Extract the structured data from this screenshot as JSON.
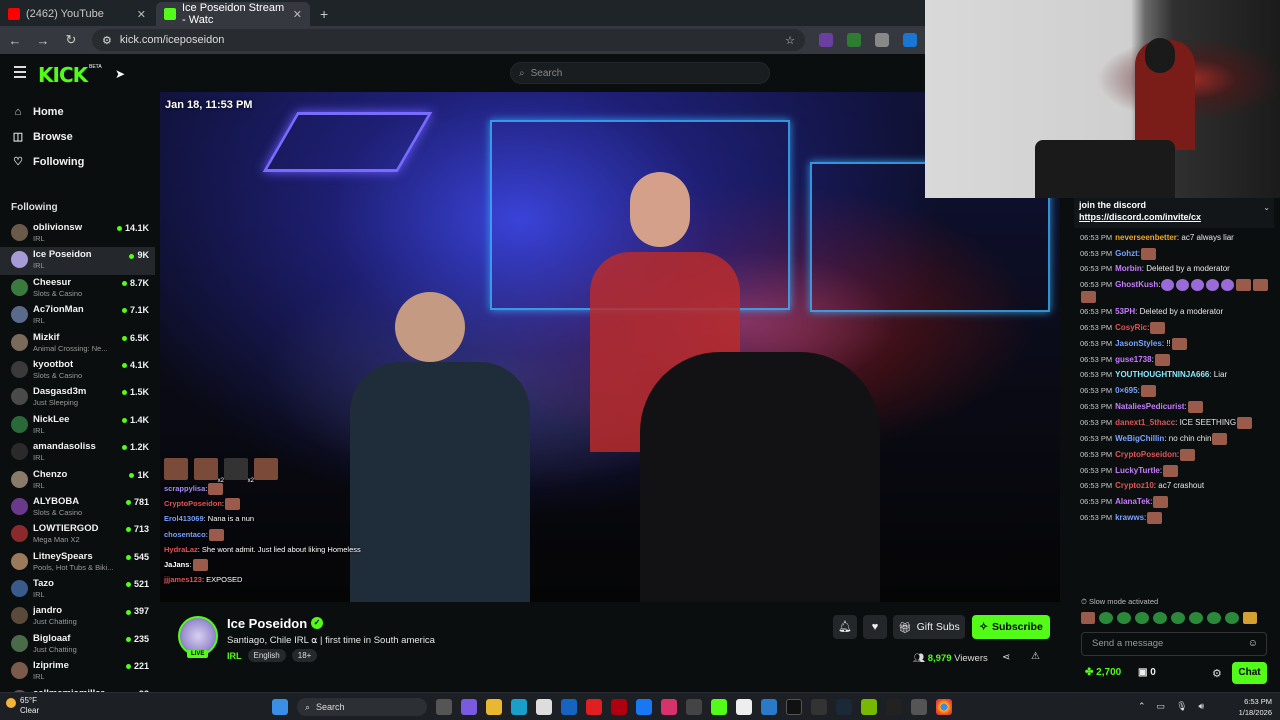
{
  "browser": {
    "tabs": [
      {
        "title": "(2462) YouTube",
        "icon": "youtube-icon",
        "color": "#ff0000"
      },
      {
        "title": "Ice Poseidon Stream - Watc",
        "icon": "kick-icon",
        "color": "#53fc18",
        "active": true
      }
    ],
    "new_tab": "+",
    "url": "kick.com/iceposeidon"
  },
  "kick": {
    "logo": "KICK",
    "beta": "BETA",
    "search_placeholder": "Search"
  },
  "nav": [
    {
      "label": "Home",
      "icon": "home-icon",
      "glyph": "⌂"
    },
    {
      "label": "Browse",
      "icon": "browse-icon",
      "glyph": "◫"
    },
    {
      "label": "Following",
      "icon": "heart-icon",
      "glyph": "♡"
    }
  ],
  "following_heading": "Following",
  "following": [
    {
      "name": "oblivionsw",
      "category": "IRL",
      "viewers": "14.1K",
      "avatar_color": "#6a5a4a"
    },
    {
      "name": "Ice Poseidon",
      "category": "IRL",
      "viewers": "9K",
      "avatar_color": "#a69bd6",
      "active": true
    },
    {
      "name": "Cheesur",
      "category": "Slots & Casino",
      "viewers": "8.7K",
      "avatar_color": "#3b7a3e"
    },
    {
      "name": "Ac7ionMan",
      "category": "IRL",
      "viewers": "7.1K",
      "avatar_color": "#5a6a8a"
    },
    {
      "name": "Mizkif",
      "category": "Animal Crossing: Ne...",
      "viewers": "6.5K",
      "avatar_color": "#7a6a5a"
    },
    {
      "name": "kyootbot",
      "category": "Slots & Casino",
      "viewers": "4.1K",
      "avatar_color": "#3a3a3a"
    },
    {
      "name": "Dasgasd3m",
      "category": "Just Sleeping",
      "viewers": "1.5K",
      "avatar_color": "#4a4a4a"
    },
    {
      "name": "NickLee",
      "category": "IRL",
      "viewers": "1.4K",
      "avatar_color": "#2a6a3a"
    },
    {
      "name": "amandasoliss",
      "category": "IRL",
      "viewers": "1.2K",
      "avatar_color": "#2a2a2a"
    },
    {
      "name": "Chenzo",
      "category": "IRL",
      "viewers": "1K",
      "avatar_color": "#8a7a6a"
    },
    {
      "name": "ALYBOBA",
      "category": "Slots & Casino",
      "viewers": "781",
      "avatar_color": "#6a3a8a"
    },
    {
      "name": "LOWTIERGOD",
      "category": "Mega Man X2",
      "viewers": "713",
      "avatar_color": "#8a2a2a"
    },
    {
      "name": "LitneySpears",
      "category": "Pools, Hot Tubs & Biki...",
      "viewers": "545",
      "avatar_color": "#9a7a5a"
    },
    {
      "name": "Tazo",
      "category": "IRL",
      "viewers": "521",
      "avatar_color": "#3a5a8a"
    },
    {
      "name": "jandro",
      "category": "Just Chatting",
      "viewers": "397",
      "avatar_color": "#5a4a3a"
    },
    {
      "name": "Bigloaaf",
      "category": "Just Chatting",
      "viewers": "235",
      "avatar_color": "#4a6a4a"
    },
    {
      "name": "Iziprime",
      "category": "IRL",
      "viewers": "221",
      "avatar_color": "#7a5a4a"
    },
    {
      "name": "callmemiamiller",
      "category": "",
      "viewers": "92",
      "avatar_color": "#6a4a5a"
    }
  ],
  "video": {
    "timestamp": "Jan 18, 11:53 PM",
    "overlay_counts": [
      "x2",
      "x2"
    ],
    "overlay_chat": [
      {
        "user": "scrappylisa",
        "text": ":",
        "color": "#a78bfa"
      },
      {
        "user": "CryptoPoseidon",
        "text": ":",
        "color": "#e05555"
      },
      {
        "user": "Erol413069",
        "text": ": Nana is a nun",
        "color": "#7aa2ff"
      },
      {
        "user": "chosentaco",
        "text": ":",
        "color": "#7aa2ff"
      },
      {
        "user": "HydraLaz",
        "text": ": She wont admit. Just lied about liking Homeless",
        "color": "#e05555"
      },
      {
        "user": "JaJans",
        "text": ":",
        "color": "#ffffff"
      },
      {
        "user": "jjjames123",
        "text": ": EXPOSED",
        "color": "#e05555"
      }
    ]
  },
  "stream": {
    "name": "Ice Poseidon",
    "live": "LIVE",
    "title": "Santiago, Chile IRL ⍺ | first time in South america",
    "category": "IRL",
    "tags": [
      "English",
      "18+"
    ],
    "gift_label": "Gift Subs",
    "subscribe_label": "Subscribe",
    "viewers": "8,979",
    "viewers_label": "Viewers"
  },
  "chat": {
    "pinned_title": "join the discord",
    "pinned_link": "https://discord.com/invite/cx",
    "messages": [
      {
        "time": "06:53 PM",
        "user": "neverseenbetter",
        "text": ": ac7 always liar",
        "color": "#f0a830"
      },
      {
        "time": "06:53 PM",
        "user": "Gohzt",
        "text": ":",
        "color": "#7aa2ff",
        "emotes": 1
      },
      {
        "time": "06:53 PM",
        "user": "Morbin",
        "text": ": Deleted by a moderator",
        "color": "#c77dff"
      },
      {
        "time": "06:53 PM",
        "user": "GhostKush",
        "text": ":",
        "color": "#c77dff",
        "emotes": 8
      },
      {
        "time": "06:53 PM",
        "user": "53PH",
        "text": ": Deleted by a moderator",
        "color": "#c77dff"
      },
      {
        "time": "06:53 PM",
        "user": "CosyRic",
        "text": ":",
        "color": "#e05555",
        "emotes": 1
      },
      {
        "time": "06:53 PM",
        "user": "JasonStyles",
        "text": ": !!",
        "color": "#7aa2ff",
        "emotes": 1
      },
      {
        "time": "06:53 PM",
        "user": "guse1738",
        "text": ":",
        "color": "#c77dff",
        "emotes": 1
      },
      {
        "time": "06:53 PM",
        "user": "YOUTHOUGHTNINJA666",
        "text": ": Liar",
        "color": "#8be9fd"
      },
      {
        "time": "06:53 PM",
        "user": "0×695",
        "text": ":",
        "color": "#7aa2ff",
        "emotes": 1
      },
      {
        "time": "06:53 PM",
        "user": "NataliesPedicurist",
        "text": ":",
        "color": "#c77dff",
        "emotes": 1
      },
      {
        "time": "06:53 PM",
        "user": "danext1_5thacc",
        "text": ": ICE SEETHING",
        "color": "#e05555",
        "emotes": 1
      },
      {
        "time": "06:53 PM",
        "user": "WeBigChillin",
        "text": ": no chin chin",
        "color": "#7aa2ff",
        "emotes": 1
      },
      {
        "time": "06:53 PM",
        "user": "CryptoPoseidon",
        "text": ":",
        "color": "#e05555",
        "emotes": 1
      },
      {
        "time": "06:53 PM",
        "user": "LuckyTurtle",
        "text": ":",
        "color": "#c77dff",
        "emotes": 1
      },
      {
        "time": "06:53 PM",
        "user": "Cryptoz10",
        "text": ": ac7 crashout",
        "color": "#e05555"
      },
      {
        "time": "06:53 PM",
        "user": "AlanaTek",
        "text": ":",
        "color": "#c77dff",
        "emotes": 1
      },
      {
        "time": "06:53 PM",
        "user": "krawws",
        "text": ":",
        "color": "#7aa2ff",
        "emotes": 1
      }
    ],
    "slow_mode": "Slow mode activated",
    "send_placeholder": "Send a message",
    "points": "2,700",
    "bits": "0",
    "chat_label": "Chat"
  },
  "taskbar": {
    "temp": "65°F",
    "condition": "Clear",
    "search_label": "Search",
    "time": "6:53 PM",
    "date": "1/18/2026"
  },
  "colors": {
    "accent": "#53fc18",
    "bg": "#0b0e0f"
  }
}
